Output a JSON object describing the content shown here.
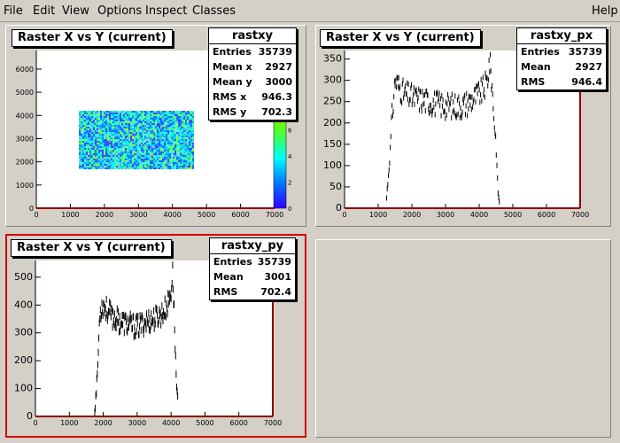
{
  "menu": {
    "file": "File",
    "edit": "Edit",
    "view": "View",
    "options": "Options",
    "inspect": "Inspect",
    "classes": "Classes",
    "help": "Help"
  },
  "pads": [
    {
      "title": "Raster X vs Y (current)",
      "stats": {
        "name": "rastxy",
        "rows": [
          {
            "label": "Entries",
            "value": "35739"
          },
          {
            "label": "Mean x",
            "value": "2927"
          },
          {
            "label": "Mean y",
            "value": "3000"
          },
          {
            "label": "RMS x",
            "value": "946.3"
          },
          {
            "label": "RMS y",
            "value": "702.3"
          }
        ]
      },
      "x_ticks": [
        "0",
        "1000",
        "2000",
        "3000",
        "4000",
        "5000",
        "6000",
        "7000"
      ],
      "y_ticks": [
        "0",
        "1000",
        "2000",
        "3000",
        "4000",
        "5000",
        "6000"
      ],
      "z_ticks": [
        "0",
        "2",
        "4",
        "6"
      ]
    },
    {
      "title": "Raster X vs Y (current)",
      "stats": {
        "name": "rastxy_px",
        "rows": [
          {
            "label": "Entries",
            "value": "35739"
          },
          {
            "label": "Mean",
            "value": "2927"
          },
          {
            "label": "RMS",
            "value": "946.4"
          }
        ]
      },
      "x_ticks": [
        "0",
        "1000",
        "2000",
        "3000",
        "4000",
        "5000",
        "6000",
        "7000"
      ],
      "y_ticks": [
        "0",
        "50",
        "100",
        "150",
        "200",
        "250",
        "300",
        "350"
      ]
    },
    {
      "title": "Raster X vs Y (current)",
      "stats": {
        "name": "rastxy_py",
        "rows": [
          {
            "label": "Entries",
            "value": "35739"
          },
          {
            "label": "Mean",
            "value": "3001"
          },
          {
            "label": "RMS",
            "value": "702.4"
          }
        ]
      },
      "x_ticks": [
        "0",
        "1000",
        "2000",
        "3000",
        "4000",
        "5000",
        "6000",
        "7000"
      ],
      "y_ticks": [
        "0",
        "100",
        "200",
        "300",
        "400",
        "500"
      ]
    }
  ],
  "colors": {
    "axis_frame": "#8b0000",
    "selected_border": "#d00000"
  },
  "chart_data": [
    {
      "type": "heatmap",
      "title": "Raster X vs Y (current)",
      "xlim": [
        0,
        7000
      ],
      "ylim": [
        0,
        6800
      ],
      "x_range_filled": [
        1250,
        4600
      ],
      "y_range_filled": [
        1750,
        4200
      ],
      "z_range": [
        0,
        7
      ]
    },
    {
      "type": "line",
      "title": "Raster X vs Y (current)",
      "xlim": [
        0,
        7000
      ],
      "ylim": [
        0,
        370
      ],
      "x": [
        1250,
        1300,
        1350,
        1400,
        1500,
        1750,
        2000,
        2500,
        3000,
        3500,
        3800,
        4100,
        4250,
        4300,
        4350,
        4500,
        4550,
        4600
      ],
      "y": [
        25,
        75,
        125,
        200,
        300,
        270,
        260,
        250,
        240,
        240,
        255,
        275,
        300,
        345,
        320,
        150,
        50,
        10
      ]
    },
    {
      "type": "line",
      "title": "Raster X vs Y (current)",
      "xlim": [
        0,
        7000
      ],
      "ylim": [
        0,
        560
      ],
      "x": [
        1750,
        1800,
        1850,
        1900,
        2000,
        2250,
        2500,
        3000,
        3250,
        3500,
        3750,
        3900,
        4000,
        4050,
        4150,
        4200
      ],
      "y": [
        20,
        100,
        210,
        380,
        400,
        360,
        340,
        320,
        340,
        350,
        370,
        400,
        450,
        520,
        150,
        50
      ]
    }
  ]
}
